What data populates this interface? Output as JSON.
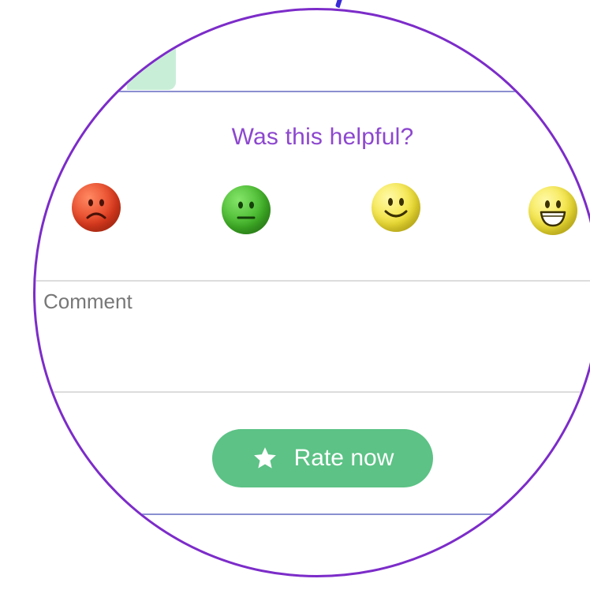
{
  "feedback": {
    "question": "Was this helpful?",
    "ratings": [
      {
        "icon": "sad-face-icon",
        "color": "#e13b1e"
      },
      {
        "icon": "neutral-face-icon",
        "color": "#3fb126"
      },
      {
        "icon": "smile-face-icon",
        "color": "#f2e133"
      },
      {
        "icon": "grin-face-icon",
        "color": "#f2e133"
      }
    ],
    "comment_placeholder": "Comment",
    "submit_label": "Rate now",
    "submit_icon": "star-icon"
  },
  "colors": {
    "accent_purple": "#8d47cf",
    "circle_border": "#7c2cc9",
    "button_green": "#5cc285",
    "divider_blue": "#8a8fd0"
  }
}
